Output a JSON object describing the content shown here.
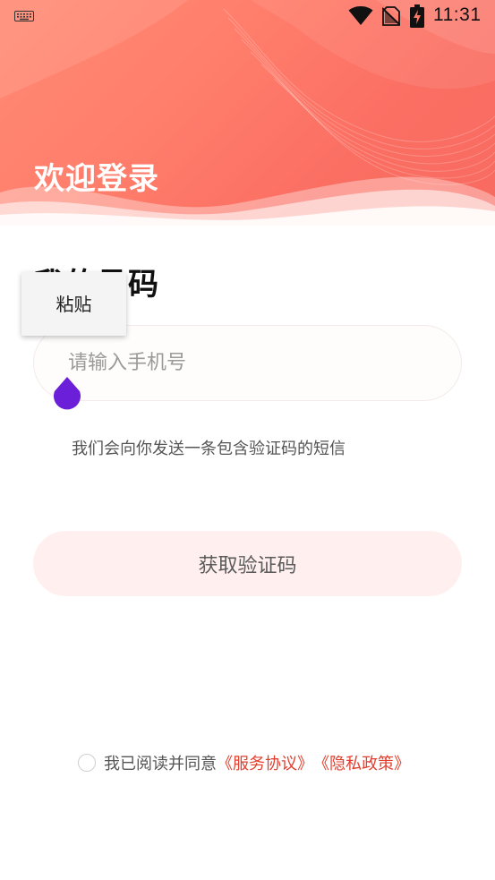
{
  "status_bar": {
    "time": "11:31",
    "icons": [
      "keyboard-icon",
      "wifi-icon",
      "no-sim-icon",
      "battery-charging-icon"
    ]
  },
  "header": {
    "title": "欢迎登录"
  },
  "form": {
    "section_title": "我的号码",
    "phone_placeholder": "请输入手机号",
    "phone_value": "",
    "hint": "我们会向你发送一条包含验证码的短信",
    "get_code_label": "获取验证码"
  },
  "context_menu": {
    "paste_label": "粘贴"
  },
  "agreement": {
    "text": "我已阅读并同意",
    "service_link": "《服务协议》",
    "privacy_link": "《隐私政策》",
    "checked": false
  },
  "colors": {
    "header_gradient_start": "#ff8a73",
    "header_gradient_end": "#f86a60",
    "link": "#e23f2f",
    "button_bg": "#fff0ef",
    "cursor_handle": "#6c1fd8"
  }
}
